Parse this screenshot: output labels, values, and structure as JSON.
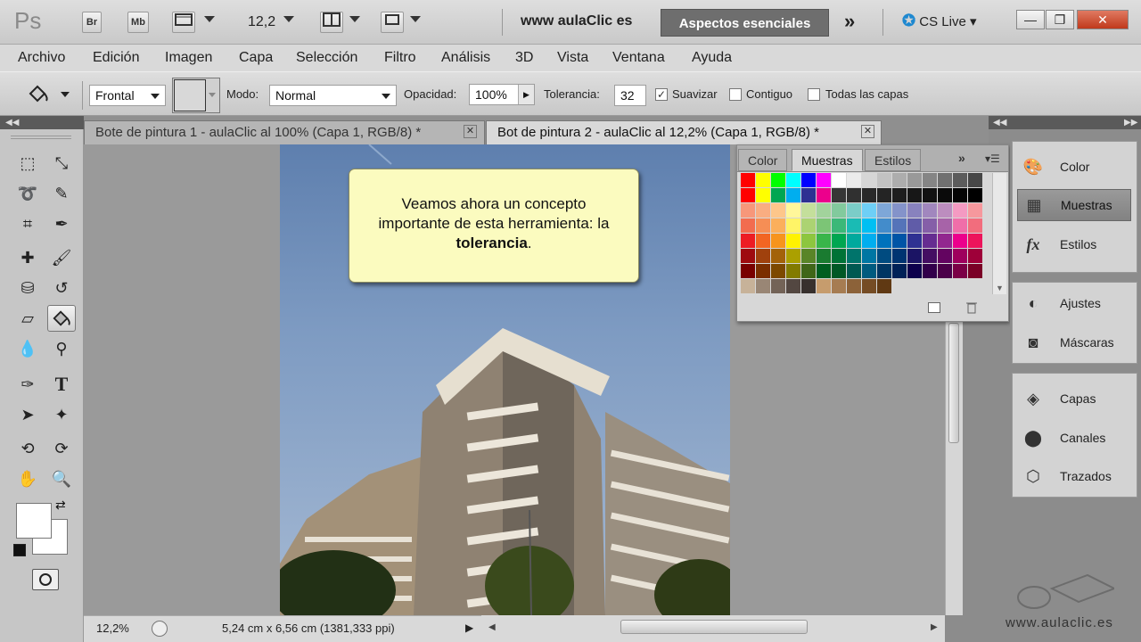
{
  "appbar": {
    "logo": "Ps",
    "bridge_label": "Br",
    "minibridge_label": "Mb",
    "zoom_value": "12,2",
    "site_label": "www aulaClic es",
    "workspace_label": "Aspectos esenciales",
    "more_label": "»",
    "cslive_label": "CS Live",
    "minimize_label": "—",
    "restore_label": "❐",
    "close_label": "✕"
  },
  "menu": [
    "Archivo",
    "Edición",
    "Imagen",
    "Capa",
    "Selección",
    "Filtro",
    "Análisis",
    "3D",
    "Vista",
    "Ventana",
    "Ayuda"
  ],
  "options": {
    "fill_source": "Frontal",
    "mode_label": "Modo:",
    "mode_value": "Normal",
    "opacity_label": "Opacidad:",
    "opacity_value": "100%",
    "tolerance_label": "Tolerancia:",
    "tolerance_value": "32",
    "antialias_label": "Suavizar",
    "antialias_checked": "✓",
    "contiguous_label": "Contiguo",
    "all_layers_label": "Todas las capas"
  },
  "tabs": [
    {
      "label": "Bote de pintura 1 - aulaClic al 100% (Capa 1, RGB/8) *",
      "close": "✕"
    },
    {
      "label": "Bot de pintura 2 - aulaClic al 12,2% (Capa 1, RGB/8) *",
      "close": "✕"
    }
  ],
  "callout": {
    "line1": "Veamos ahora un concepto",
    "line2": "importante de esta herramienta: la",
    "bold": "tolerancia",
    "tail": "."
  },
  "swatches_panel": {
    "tabs": [
      "Color",
      "Muestras",
      "Estilos"
    ],
    "menu_icon": "»",
    "swatch_colors": [
      "#ff0000",
      "#ffff00",
      "#00ff00",
      "#00ffff",
      "#0000ff",
      "#ff00ff",
      "#ffffff",
      "#ebebeb",
      "#d6d6d6",
      "#c2c2c2",
      "#adadad",
      "#999999",
      "#858585",
      "#707070",
      "#5c5c5c",
      "#474747",
      "#ff0000",
      "#ffff00",
      "#00a651",
      "#00aeef",
      "#2e3192",
      "#ec008c",
      "#363636",
      "#303030",
      "#292929",
      "#242424",
      "#1e1e1e",
      "#171717",
      "#111111",
      "#0a0a0a",
      "#050505",
      "#000000",
      "#f7977a",
      "#f9ad81",
      "#fdc68a",
      "#fff79a",
      "#c4df9b",
      "#a2d39c",
      "#82ca9d",
      "#7bcdc8",
      "#6ecff6",
      "#7ea7d8",
      "#8493ca",
      "#8882be",
      "#a187be",
      "#bc8dbf",
      "#f49ac2",
      "#f6989d",
      "#f26c4f",
      "#f68e55",
      "#fbaf5c",
      "#fff467",
      "#acd372",
      "#7cc576",
      "#3bb878",
      "#1abbb4",
      "#00bff3",
      "#438ccb",
      "#5574b9",
      "#605ca8",
      "#855fa8",
      "#a763a8",
      "#f06ea9",
      "#f26d7d",
      "#ed1c24",
      "#f26522",
      "#f7941d",
      "#fff200",
      "#8dc63f",
      "#39b54a",
      "#00a651",
      "#00a99d",
      "#00aeef",
      "#0072bc",
      "#0054a6",
      "#2e3192",
      "#662d91",
      "#92278f",
      "#ec008c",
      "#ed145b",
      "#9e0b0f",
      "#a0410d",
      "#a3620a",
      "#aba000",
      "#598527",
      "#1a7b30",
      "#007236",
      "#00746b",
      "#0076a3",
      "#004b80",
      "#003471",
      "#1b1464",
      "#440e62",
      "#630460",
      "#9e005d",
      "#9e0039",
      "#790000",
      "#7b2e00",
      "#7d4900",
      "#827b00",
      "#406618",
      "#005e20",
      "#005826",
      "#005952",
      "#005b7f",
      "#003663",
      "#002157",
      "#0d004c",
      "#32004b",
      "#4b0049",
      "#7b0046",
      "#7a0026",
      "#c7b299",
      "#998675",
      "#736357",
      "#534741",
      "#37302d",
      "#c69c6d",
      "#a67c52",
      "#8c6239",
      "#754c24",
      "#603913"
    ]
  },
  "dock": {
    "group1": [
      {
        "label": "Color",
        "icon": "palette-icon"
      },
      {
        "label": "Muestras",
        "icon": "swatches-icon"
      },
      {
        "label": "Estilos",
        "icon": "fx-icon"
      }
    ],
    "group2": [
      {
        "label": "Ajustes",
        "icon": "adjustments-icon"
      },
      {
        "label": "Máscaras",
        "icon": "masks-icon"
      }
    ],
    "group3": [
      {
        "label": "Capas",
        "icon": "layers-icon"
      },
      {
        "label": "Canales",
        "icon": "channels-icon"
      },
      {
        "label": "Trazados",
        "icon": "paths-icon"
      }
    ]
  },
  "status": {
    "zoom": "12,2%",
    "doc_size": "5,24 cm x 6,56 cm (1381,333 ppi)"
  },
  "watermark": "www.aulaclic.es"
}
